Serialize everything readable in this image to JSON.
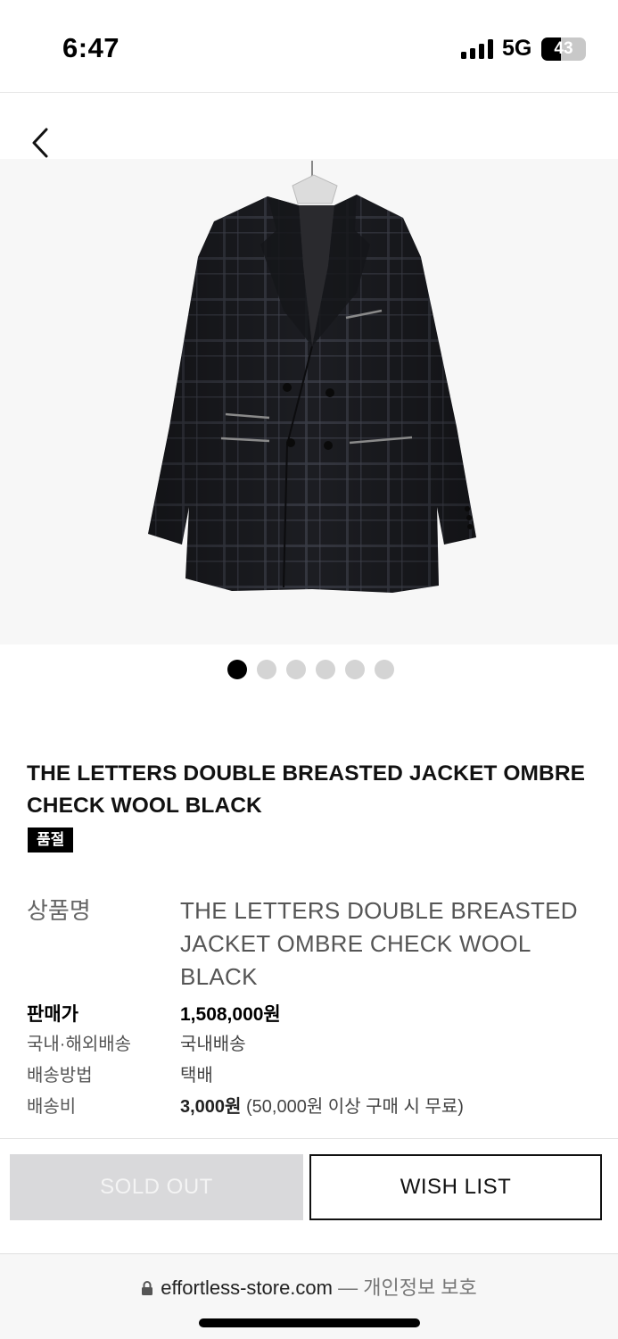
{
  "status_bar": {
    "time": "6:47",
    "network": "5G",
    "battery": "43",
    "battery_level": 0.43,
    "icons": [
      "signal-icon",
      "battery-icon"
    ]
  },
  "nav": {
    "back_icon": "chevron-left-icon"
  },
  "product": {
    "image": "product-photo",
    "carousel": {
      "count": 6,
      "active_index": 0
    },
    "title": "THE LETTERS DOUBLE BREASTED JACKET OMBRE CHECK WOOL BLACK",
    "badge": "품절"
  },
  "info": {
    "name_label": "상품명",
    "name_value": "THE LETTERS DOUBLE BREASTED JACKET OMBRE CHECK WOOL BLACK",
    "price_label": "판매가",
    "price_value": "1,508,000원",
    "shipping_region_label": "국내·해외배송",
    "shipping_region_value": "국내배송",
    "shipping_method_label": "배송방법",
    "shipping_method_value": "택배",
    "shipping_fee_label": "배송비",
    "shipping_fee_amount": "3,000원",
    "shipping_fee_note": "(50,000원 이상 구매 시 무료)"
  },
  "actions": {
    "soldout_label": "SOLD OUT",
    "wishlist_label": "WISH LIST"
  },
  "browser": {
    "domain": "effortless-store.com",
    "separator": "—",
    "privacy": "개인정보 보호",
    "lock_icon": "lock-icon"
  }
}
